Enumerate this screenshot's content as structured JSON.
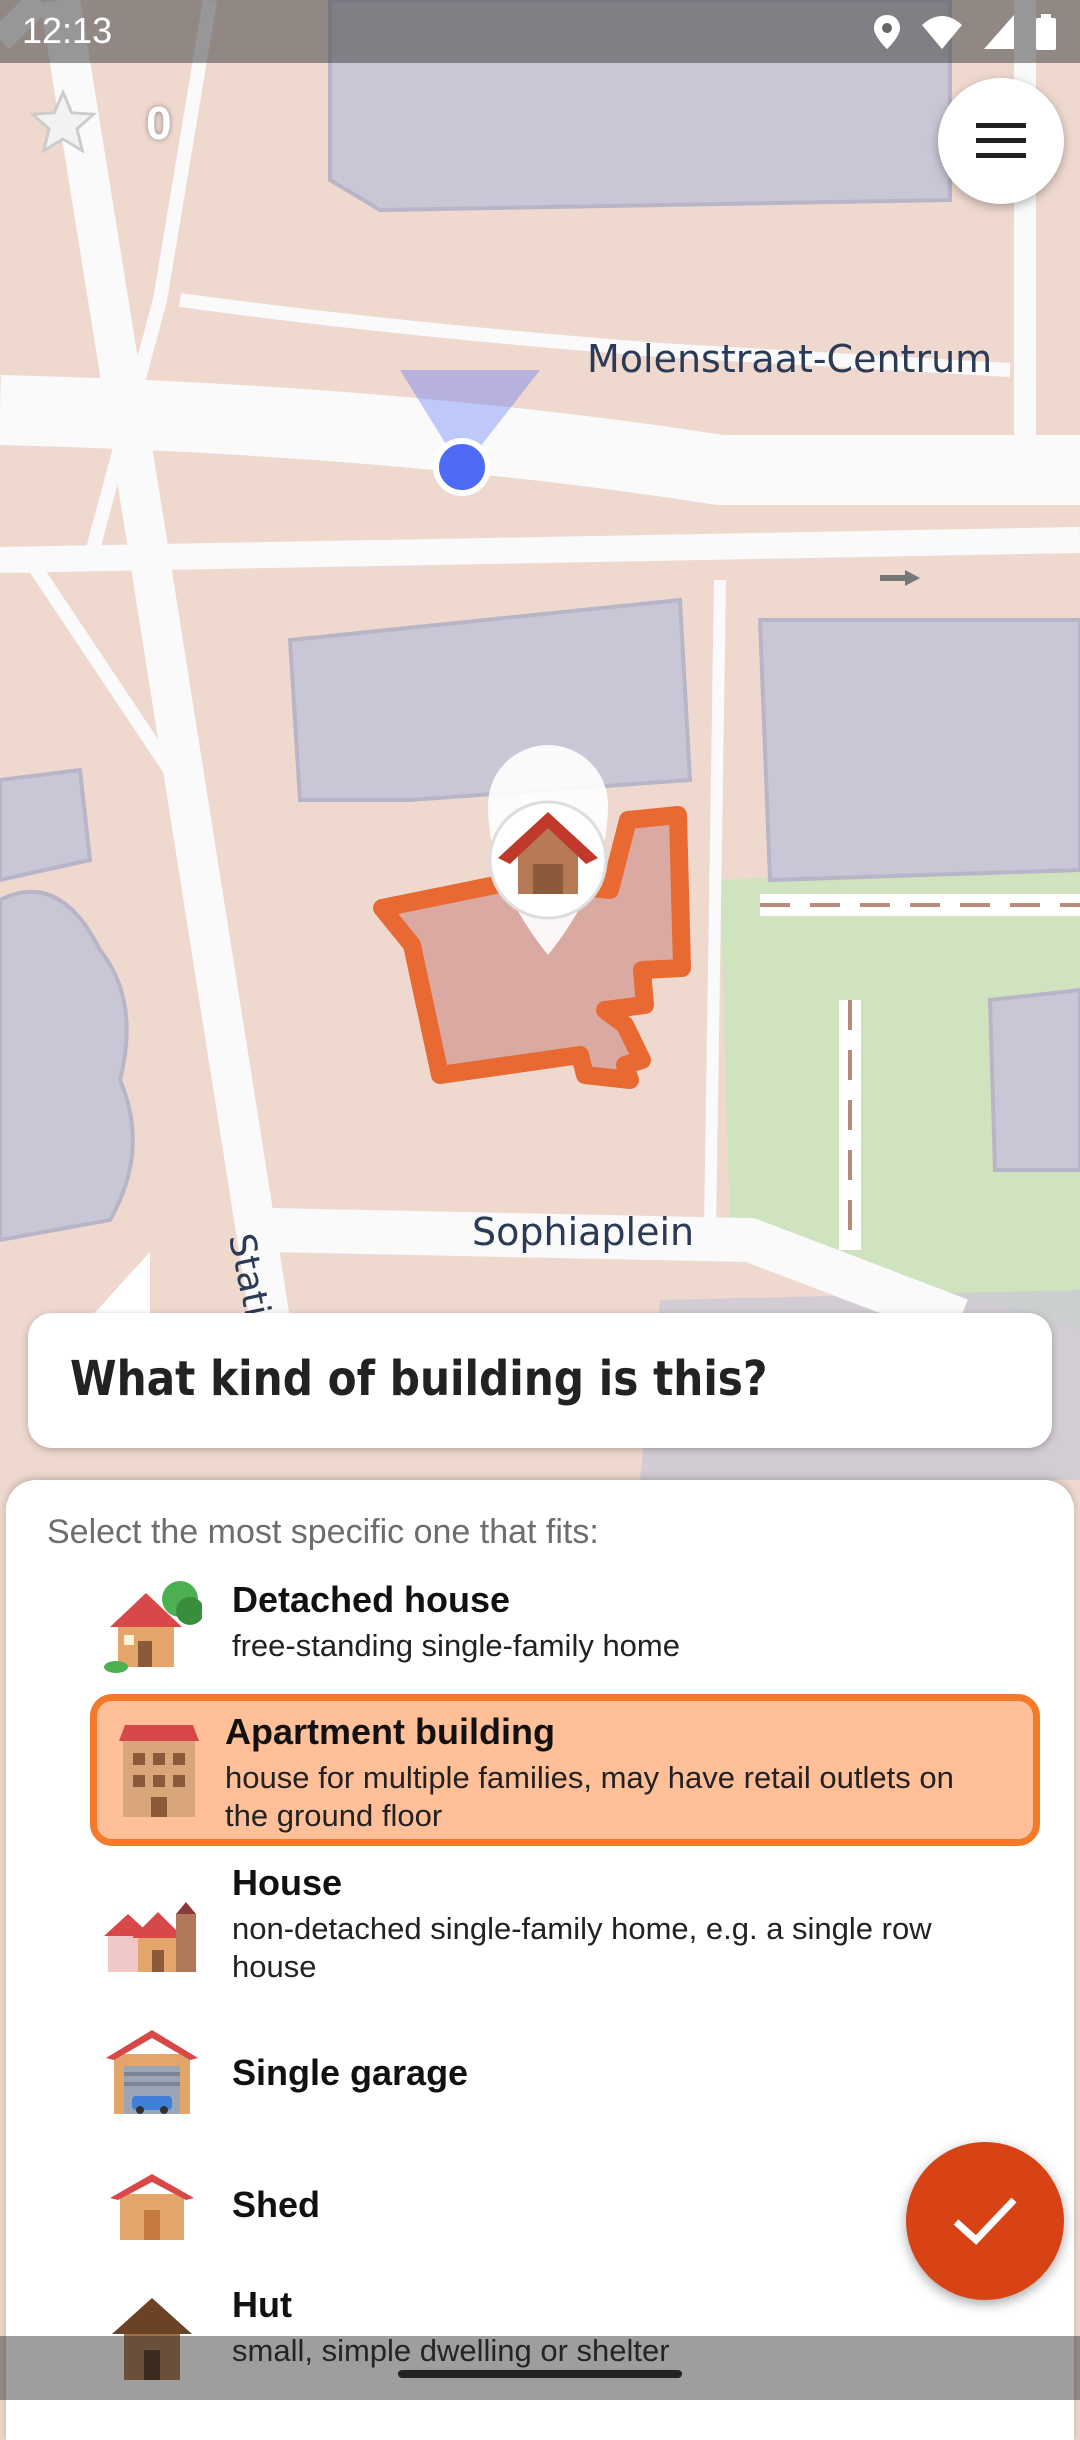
{
  "status_bar": {
    "time": "12:13",
    "icons": [
      "location-icon",
      "wifi-icon",
      "signal-icon",
      "battery-icon"
    ]
  },
  "top_controls": {
    "star_count": "0",
    "menu_icon": "hamburger-menu-icon"
  },
  "map": {
    "street_labels": {
      "north": "Molenstraat-Centrum",
      "south": "Sophiaplein",
      "west": "Stations"
    },
    "marker_icon": "house-icon",
    "colors": {
      "background": "#efd9cf",
      "building": "#c9c6d6",
      "road": "#fafafa",
      "park": "#cfe3be",
      "highlight": "#e8642a",
      "location": "#4d6bf5"
    }
  },
  "quest": {
    "title": "What kind of building is this?"
  },
  "answers": {
    "hint": "Select the most specific one that fits:",
    "options": [
      {
        "title": "Detached house",
        "description": "free-standing single-family home",
        "icon": "detached-house-icon",
        "selected": false
      },
      {
        "title": "Apartment building",
        "description": "house for multiple families, may have retail outlets on the ground floor",
        "icon": "apartment-building-icon",
        "selected": true
      },
      {
        "title": "House",
        "description": "non-detached single-family home, e.g. a single row house",
        "icon": "row-house-icon",
        "selected": false
      },
      {
        "title": "Single garage",
        "description": "",
        "icon": "garage-icon",
        "selected": false
      },
      {
        "title": "Shed",
        "description": "",
        "icon": "shed-icon",
        "selected": false
      },
      {
        "title": "Hut",
        "description": "small, simple dwelling or shelter",
        "icon": "hut-icon",
        "selected": false
      }
    ],
    "confirm_icon": "checkmark-icon"
  }
}
